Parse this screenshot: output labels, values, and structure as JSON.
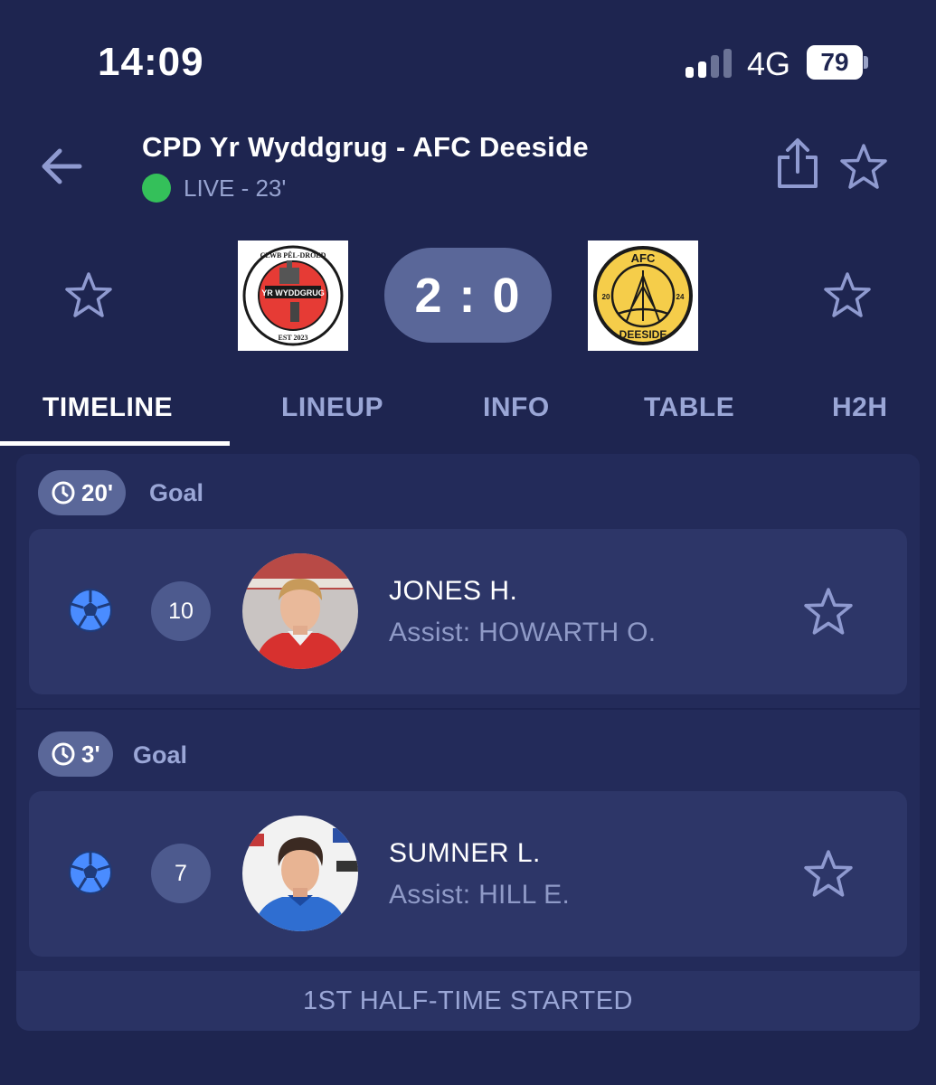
{
  "status_bar": {
    "time": "14:09",
    "network": "4G",
    "battery": "79"
  },
  "header": {
    "title": "CPD Yr Wyddgrug - AFC Deeside",
    "live": "LIVE - 23'"
  },
  "score": {
    "display": "2 : 0",
    "home": {
      "crest_text": [
        "CLWB PÊL-DROED",
        "YR WYDDGRUG",
        "EST 2023"
      ]
    },
    "away": {
      "crest_text": [
        "AFC",
        "20",
        "24",
        "DEESIDE"
      ]
    }
  },
  "tabs": [
    "TIMELINE",
    "LINEUP",
    "INFO",
    "TABLE",
    "H2H"
  ],
  "events": [
    {
      "minute": "20'",
      "type": "Goal",
      "shirt": "10",
      "player": "JONES H.",
      "assist": "Assist: HOWARTH O."
    },
    {
      "minute": "3'",
      "type": "Goal",
      "shirt": "7",
      "player": "SUMNER L.",
      "assist": "Assist: HILL E."
    }
  ],
  "half_time": "1ST HALF-TIME STARTED",
  "colors": {
    "background": "#1e2550",
    "card": "#2d3668",
    "accent_text": "#9aa6d6",
    "pill": "#5a6799",
    "live": "#34c05a",
    "ball": "#4a8cff"
  }
}
